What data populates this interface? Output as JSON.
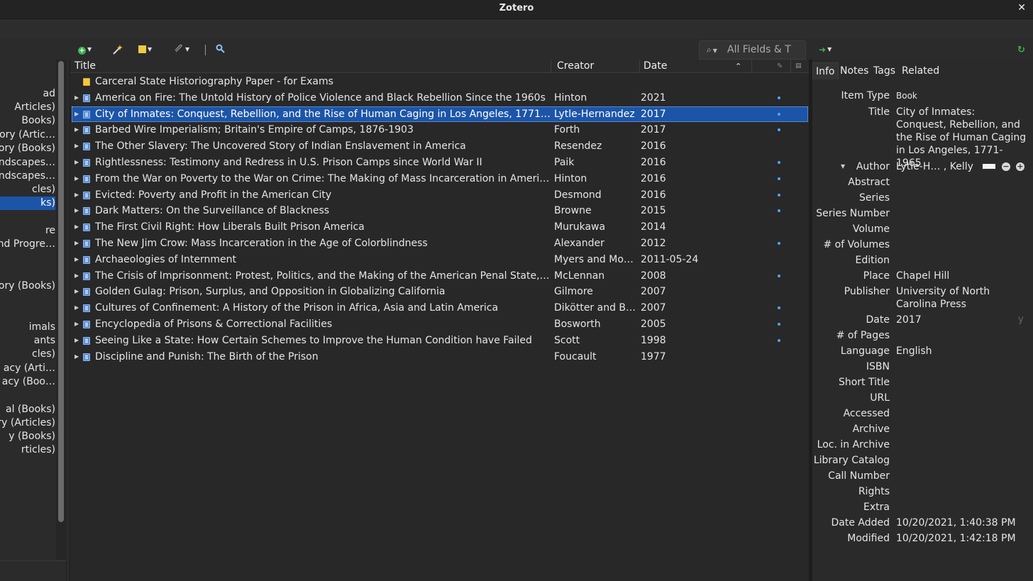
{
  "window": {
    "title": "Zotero",
    "close_glyph": "✕"
  },
  "toolbar": {
    "new_item_icon": "green-plus-icon",
    "add_by_identifier_icon": "magic-wand-icon",
    "new_note_icon": "note-icon",
    "attachment_icon": "paperclip-icon",
    "locate_icon": "search-icon",
    "search_placeholder": "All Fields & T",
    "sync_icon": "sync-icon",
    "go_icon": "arrow-right-icon"
  },
  "collections": [
    "ad",
    "Articles)",
    "Books)",
    "ory (Artic…",
    "ory (Books)",
    "ndscapes…",
    "ndscapes…",
    "cles)",
    "ks)",
    "re",
    "nd Progre…",
    "tory (Books)",
    "imals",
    "ants",
    "cles)",
    "acy (Arti…",
    "acy (Boo…",
    "al (Books)",
    "ry (Articles)",
    "y (Books)",
    "rticles)"
  ],
  "columns": {
    "title": "Title",
    "creator": "Creator",
    "date": "Date"
  },
  "items": [
    {
      "title": "Carceral State Historiography Paper - for Exams",
      "creator": "",
      "date": "",
      "type": "note",
      "attachment": false
    },
    {
      "title": "America on Fire: The Untold History of Police Violence and Black Rebellion Since the 1960s",
      "creator": "Hinton",
      "date": "2021",
      "type": "book",
      "attachment": true
    },
    {
      "title": "City of Inmates: Conquest, Rebellion, and the Rise of Human Caging in Los Angeles, 1771-1965",
      "creator": "Lytle-Hernandez",
      "date": "2017",
      "type": "book",
      "attachment": true,
      "selected": true
    },
    {
      "title": "Barbed Wire Imperialism; Britain's Empire of Camps, 1876-1903",
      "creator": "Forth",
      "date": "2017",
      "type": "book",
      "attachment": true
    },
    {
      "title": "The Other Slavery: The Uncovered Story of Indian Enslavement in America",
      "creator": "Resendez",
      "date": "2016",
      "type": "book",
      "attachment": false
    },
    {
      "title": "Rightlessness: Testimony and Redress in U.S. Prison Camps since World War II",
      "creator": "Paik",
      "date": "2016",
      "type": "book",
      "attachment": true
    },
    {
      "title": "From the War on Poverty to the War on Crime: The Making of Mass Incarceration in America",
      "creator": "Hinton",
      "date": "2016",
      "type": "book",
      "attachment": true
    },
    {
      "title": "Evicted: Poverty and Profit in the American City",
      "creator": "Desmond",
      "date": "2016",
      "type": "book",
      "attachment": true
    },
    {
      "title": "Dark Matters: On the Surveillance of Blackness",
      "creator": "Browne",
      "date": "2015",
      "type": "book",
      "attachment": true
    },
    {
      "title": "The First Civil Right: How Liberals Built Prison America",
      "creator": "Murukawa",
      "date": "2014",
      "type": "book",
      "attachment": false
    },
    {
      "title": "The New Jim Crow: Mass Incarceration in the Age of Colorblindness",
      "creator": "Alexander",
      "date": "2012",
      "type": "book",
      "attachment": true
    },
    {
      "title": "Archaeologies of Internment",
      "creator": "Myers and Mos…",
      "date": "2011-05-24",
      "type": "book",
      "attachment": false
    },
    {
      "title": "The Crisis of Imprisonment: Protest, Politics, and the Making of the American Penal State, 1776…",
      "creator": "McLennan",
      "date": "2008",
      "type": "book",
      "attachment": true
    },
    {
      "title": "Golden Gulag: Prison, Surplus, and Opposition in Globalizing California",
      "creator": "Gilmore",
      "date": "2007",
      "type": "book",
      "attachment": false
    },
    {
      "title": "Cultures of Confinement: A History of the Prison in Africa, Asia and Latin America",
      "creator": "Dikötter and Br…",
      "date": "2007",
      "type": "book",
      "attachment": true
    },
    {
      "title": "Encyclopedia of Prisons & Correctional Facilities",
      "creator": "Bosworth",
      "date": "2005",
      "type": "book",
      "attachment": true
    },
    {
      "title": "Seeing Like a State: How Certain Schemes to Improve the Human Condition have Failed",
      "creator": "Scott",
      "date": "1998",
      "type": "book",
      "attachment": true
    },
    {
      "title": "Discipline and Punish: The Birth of the Prison",
      "creator": "Foucault",
      "date": "1977",
      "type": "book",
      "attachment": false
    }
  ],
  "tabs": [
    "Info",
    "Notes",
    "Tags",
    "Related"
  ],
  "info": [
    {
      "label": "Item Type",
      "value": "Book"
    },
    {
      "label": "Title",
      "value": "City of Inmates: Conquest, Rebellion, and the Rise of Human Caging in Los Angeles, 1771-1965"
    },
    {
      "label": "Author",
      "value": "Lytle-H… , Kelly"
    },
    {
      "label": "Abstract",
      "value": ""
    },
    {
      "label": "Series",
      "value": ""
    },
    {
      "label": "Series Number",
      "value": ""
    },
    {
      "label": "Volume",
      "value": ""
    },
    {
      "label": "# of Volumes",
      "value": ""
    },
    {
      "label": "Edition",
      "value": ""
    },
    {
      "label": "Place",
      "value": "Chapel Hill"
    },
    {
      "label": "Publisher",
      "value": "University of North Carolina Press"
    },
    {
      "label": "Date",
      "value": "2017",
      "extra": "y"
    },
    {
      "label": "# of Pages",
      "value": ""
    },
    {
      "label": "Language",
      "value": "English"
    },
    {
      "label": "ISBN",
      "value": ""
    },
    {
      "label": "Short Title",
      "value": ""
    },
    {
      "label": "URL",
      "value": ""
    },
    {
      "label": "Accessed",
      "value": ""
    },
    {
      "label": "Archive",
      "value": ""
    },
    {
      "label": "Loc. in Archive",
      "value": ""
    },
    {
      "label": "Library Catalog",
      "value": ""
    },
    {
      "label": "Call Number",
      "value": ""
    },
    {
      "label": "Rights",
      "value": ""
    },
    {
      "label": "Extra",
      "value": ""
    },
    {
      "label": "Date Added",
      "value": "10/20/2021, 1:40:38 PM"
    },
    {
      "label": "Modified",
      "value": "10/20/2021, 1:42:18 PM"
    }
  ],
  "colors": {
    "selection": "#1c55a8",
    "accent": "#4aa8ff",
    "background": "#282828"
  }
}
